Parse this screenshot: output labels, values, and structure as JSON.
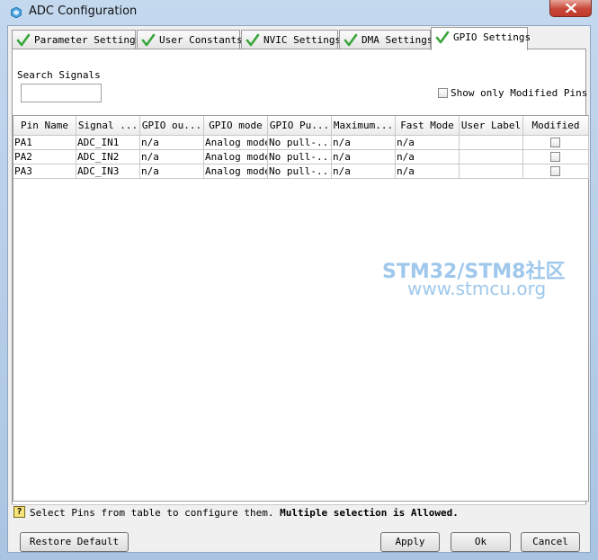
{
  "window": {
    "title": "ADC Configuration"
  },
  "tabs": [
    {
      "label": "Parameter Settings",
      "active": false
    },
    {
      "label": "User Constants",
      "active": false
    },
    {
      "label": "NVIC Settings",
      "active": false
    },
    {
      "label": "DMA Settings",
      "active": false
    },
    {
      "label": "GPIO Settings",
      "active": true
    }
  ],
  "search": {
    "label": "Search Signals",
    "value": ""
  },
  "show_modified": {
    "label": "Show only Modified Pins",
    "checked": false
  },
  "table": {
    "columns": [
      "Pin Name",
      "Signal ...",
      "GPIO ou...",
      "GPIO mode",
      "GPIO Pu...",
      "Maximum...",
      "Fast Mode",
      "User Label",
      "Modified"
    ],
    "rows": [
      [
        "PA1",
        "ADC_IN1",
        "n/a",
        "Analog mode",
        "No pull-...",
        "n/a",
        "n/a",
        "",
        ""
      ],
      [
        "PA2",
        "ADC_IN2",
        "n/a",
        "Analog mode",
        "No pull-...",
        "n/a",
        "n/a",
        "",
        ""
      ],
      [
        "PA3",
        "ADC_IN3",
        "n/a",
        "Analog mode",
        "No pull-...",
        "n/a",
        "n/a",
        "",
        ""
      ]
    ]
  },
  "watermark": {
    "line1": "STM32/STM8社区",
    "line2": "www.stmcu.org"
  },
  "status": {
    "text": "Select Pins from table to configure them. ",
    "bold": "Multiple selection is Allowed."
  },
  "buttons": {
    "restore": "Restore Default",
    "apply": "Apply",
    "ok": "Ok",
    "cancel": "Cancel"
  },
  "colors": {
    "check_green": "#3aa53a",
    "close_red": "#c8473a",
    "watermark": "#9fc8ec"
  }
}
